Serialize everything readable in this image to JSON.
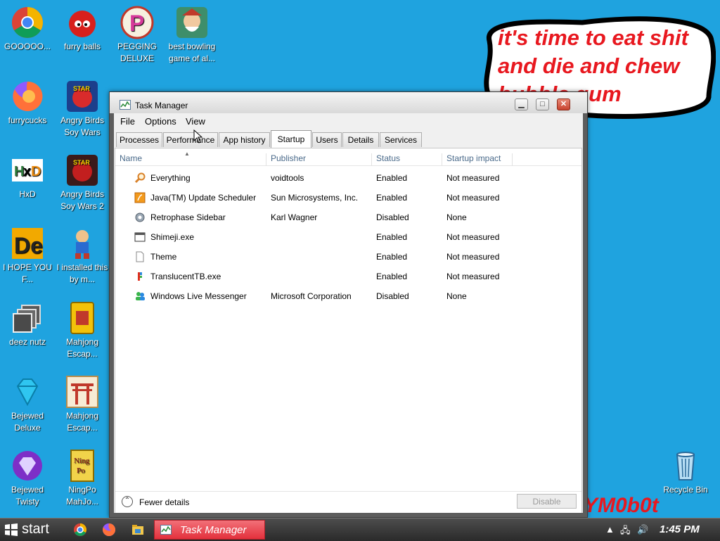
{
  "desktop": {
    "background_color": "#1fa3df",
    "icons": [
      {
        "label": "GOOOOO...",
        "icon": "chrome-icon"
      },
      {
        "label": "furry balls",
        "icon": "red-furball-icon"
      },
      {
        "label": "PEGGING DELUXE",
        "icon": "peggle-icon"
      },
      {
        "label": "best bowling game of al...",
        "icon": "bowling-elf-icon"
      },
      {
        "label": "furrycucks",
        "icon": "firefox-icon"
      },
      {
        "label": "Angry Birds Soy Wars",
        "icon": "angry-birds-icon"
      },
      {
        "label": "HxD",
        "icon": "hxd-icon"
      },
      {
        "label": "Angry Birds Soy Wars 2",
        "icon": "angry-birds-2-icon"
      },
      {
        "label": "I HOPE YOU F...",
        "icon": "de-icon"
      },
      {
        "label": "I installed this by m...",
        "icon": "game-character-icon"
      },
      {
        "label": "deez nutz",
        "icon": "window-stack-icon"
      },
      {
        "label": "Mahjong Escap...",
        "icon": "mahjong-icon"
      },
      {
        "label": "Bejewed Deluxe",
        "icon": "diamond-icon"
      },
      {
        "label": "Mahjong Escap...",
        "icon": "torii-gate-icon"
      },
      {
        "label": "Bejewed Twisty",
        "icon": "bejeweled-twist-icon"
      },
      {
        "label": "NingPo MahJo...",
        "icon": "ningpo-icon"
      },
      {
        "label": "Recycle Bin",
        "icon": "recycle-bin-icon"
      }
    ],
    "speech_bubble_text": "it's time to eat shit and die and chew bubble gum",
    "background_text": "YM0b0t"
  },
  "window": {
    "title": "Task Manager",
    "menu": [
      "File",
      "Options",
      "View"
    ],
    "tabs": [
      "Processes",
      "Performance",
      "App history",
      "Startup",
      "Users",
      "Details",
      "Services"
    ],
    "active_tab": "Startup",
    "columns": [
      "Name",
      "Publisher",
      "Status",
      "Startup impact"
    ],
    "rows": [
      {
        "name": "Everything",
        "publisher": "voidtools",
        "status": "Enabled",
        "impact": "Not measured",
        "icon": "magnifier-icon"
      },
      {
        "name": "Java(TM) Update Scheduler",
        "publisher": "Sun Microsystems, Inc.",
        "status": "Enabled",
        "impact": "Not measured",
        "icon": "java-icon"
      },
      {
        "name": "Retrophase Sidebar",
        "publisher": "Karl Wagner",
        "status": "Disabled",
        "impact": "None",
        "icon": "gear-icon"
      },
      {
        "name": "Shimeji.exe",
        "publisher": "",
        "status": "Enabled",
        "impact": "Not measured",
        "icon": "app-window-icon"
      },
      {
        "name": "Theme",
        "publisher": "",
        "status": "Enabled",
        "impact": "Not measured",
        "icon": "blank-file-icon"
      },
      {
        "name": "TranslucentTB.exe",
        "publisher": "",
        "status": "Enabled",
        "impact": "Not measured",
        "icon": "translucenttb-icon"
      },
      {
        "name": "Windows Live Messenger",
        "publisher": "Microsoft Corporation",
        "status": "Disabled",
        "impact": "None",
        "icon": "messenger-icon"
      }
    ],
    "footer": {
      "fewer_details": "Fewer details",
      "disable_button": "Disable"
    }
  },
  "taskbar": {
    "start_label": "start",
    "task_label": "Task Manager",
    "clock": "1:45 PM",
    "colors": {
      "task_button": "#e3303c"
    }
  }
}
